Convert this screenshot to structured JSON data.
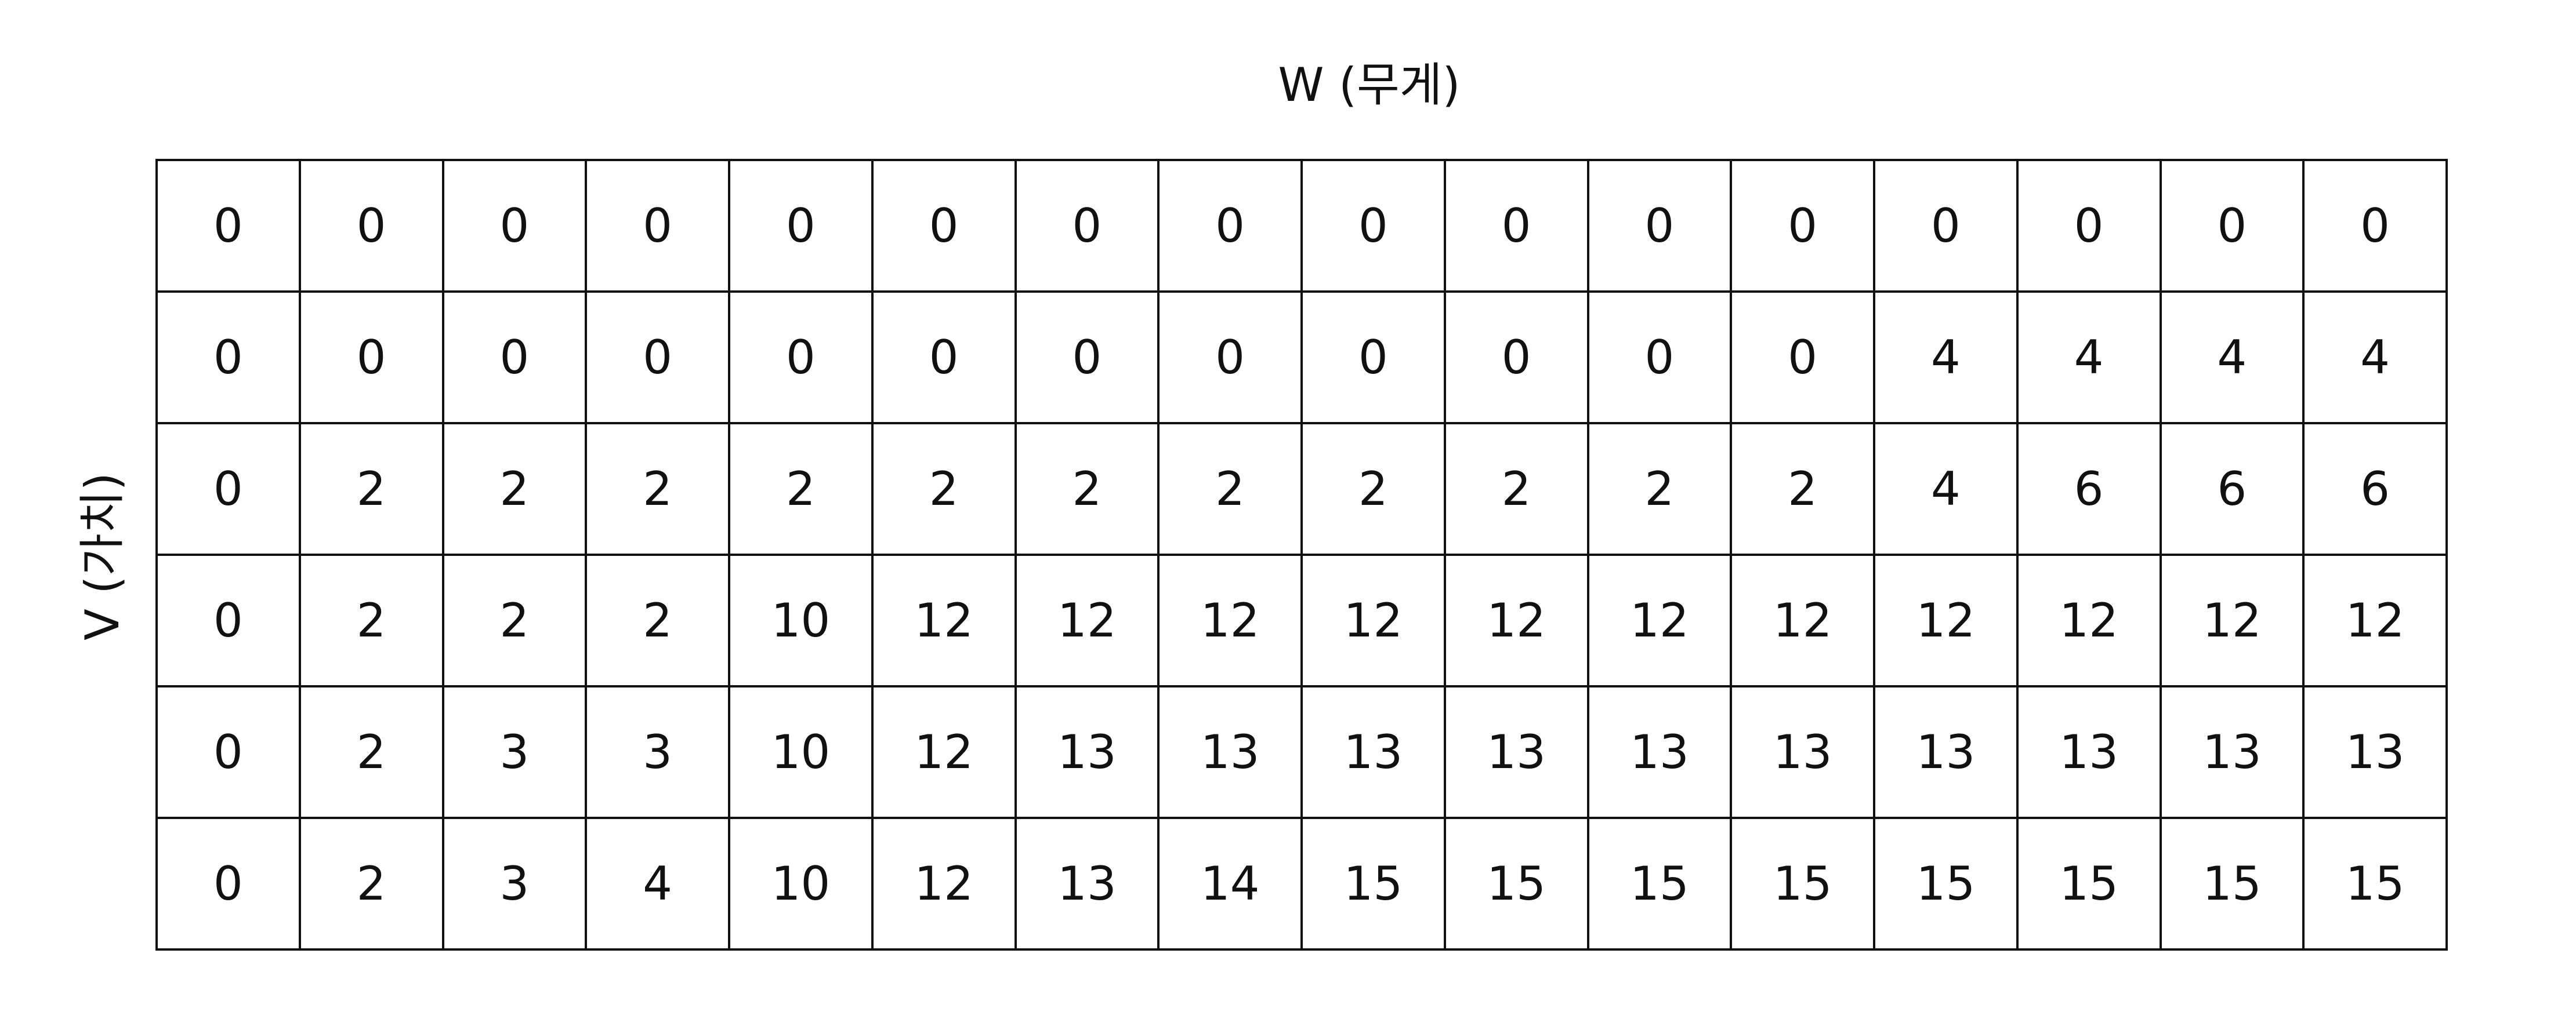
{
  "x_axis_label": "W (무게)",
  "y_axis_label": "V (가치)",
  "table": {
    "rows": [
      [
        "0",
        "0",
        "0",
        "0",
        "0",
        "0",
        "0",
        "0",
        "0",
        "0",
        "0",
        "0",
        "0",
        "0",
        "0",
        "0"
      ],
      [
        "0",
        "0",
        "0",
        "0",
        "0",
        "0",
        "0",
        "0",
        "0",
        "0",
        "0",
        "0",
        "4",
        "4",
        "4",
        "4"
      ],
      [
        "0",
        "2",
        "2",
        "2",
        "2",
        "2",
        "2",
        "2",
        "2",
        "2",
        "2",
        "2",
        "4",
        "6",
        "6",
        "6"
      ],
      [
        "0",
        "2",
        "2",
        "2",
        "10",
        "12",
        "12",
        "12",
        "12",
        "12",
        "12",
        "12",
        "12",
        "12",
        "12",
        "12"
      ],
      [
        "0",
        "2",
        "3",
        "3",
        "10",
        "12",
        "13",
        "13",
        "13",
        "13",
        "13",
        "13",
        "13",
        "13",
        "13",
        "13"
      ],
      [
        "0",
        "2",
        "3",
        "4",
        "10",
        "12",
        "13",
        "14",
        "15",
        "15",
        "15",
        "15",
        "15",
        "15",
        "15",
        "15"
      ]
    ]
  }
}
